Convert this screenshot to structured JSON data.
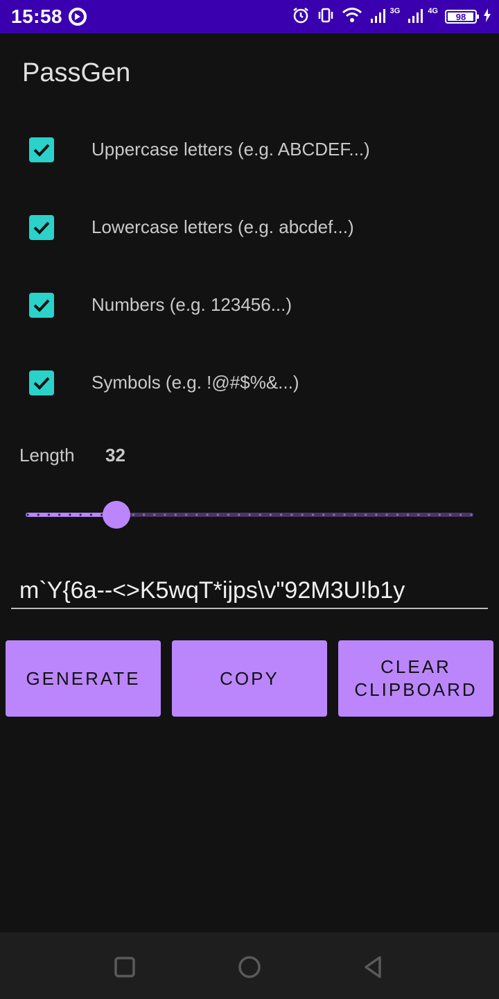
{
  "status_bar": {
    "time": "15:58",
    "network_labels": [
      "3G",
      "4G"
    ],
    "battery_level": 98,
    "battery_text": "98"
  },
  "app": {
    "title": "PassGen"
  },
  "options": [
    {
      "label": "Uppercase letters (e.g. ABCDEF...)",
      "checked": true
    },
    {
      "label": "Lowercase letters (e.g. abcdef...)",
      "checked": true
    },
    {
      "label": "Numbers (e.g. 123456...)",
      "checked": true
    },
    {
      "label": "Symbols (e.g. !@#$%&...)",
      "checked": true
    }
  ],
  "length": {
    "label": "Length",
    "value": "32",
    "slider": {
      "value": 32,
      "min": 8,
      "max": 128
    }
  },
  "password": {
    "value": "m`Y{6a--<>K5wqT*ijps\\v\"92M3U!b1y"
  },
  "buttons": {
    "generate": "GENERATE",
    "copy": "COPY",
    "clear_line1": "CLEAR",
    "clear_line2": "CLIPBOARD"
  },
  "colors": {
    "status_bar": "#3a00b0",
    "accent": "#bb86fc",
    "checkbox": "#2ad2c9",
    "background": "#121212"
  },
  "nav_icons": [
    "recents-icon",
    "home-icon",
    "back-icon"
  ]
}
